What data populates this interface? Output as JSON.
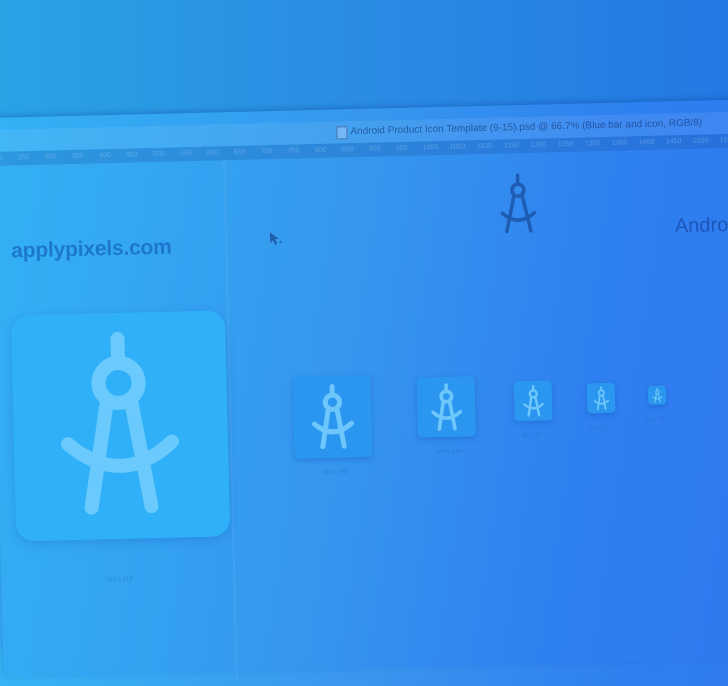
{
  "window": {
    "title": "Android Product Icon Template (9-15).psd @ 66.7% (Blue bar and icon, RGB/8)",
    "ruler_ticks": [
      "200",
      "250",
      "300",
      "350",
      "400",
      "450",
      "500",
      "550",
      "600",
      "650",
      "700",
      "750",
      "800",
      "850",
      "900",
      "950",
      "1000",
      "1050",
      "1100",
      "1150",
      "1200",
      "1250",
      "1300",
      "1350",
      "1400",
      "1450",
      "1500",
      "1550",
      "1600",
      "1650",
      "1700",
      "1750",
      "1800",
      "1850",
      "1900",
      "1950",
      "2000"
    ]
  },
  "canvas": {
    "brand": "applypixels.com",
    "right_title": "Andro",
    "large_icon_label": "512 x 512",
    "icon_sizes": [
      {
        "label": "192 x 192"
      },
      {
        "label": "144 x 144"
      },
      {
        "label": "96 x 96"
      },
      {
        "label": "72 x 72"
      },
      {
        "label": "48 x 48"
      }
    ]
  },
  "colors": {
    "background_left": "#36b4f6",
    "background_right": "#3179ee",
    "icon_tile": "#2b96f0",
    "large_icon": "#2fb0f8",
    "glyph": "#7fd3ff",
    "brand_text": "#196ec8"
  },
  "icons": {
    "app_glyph": "drafting-compass-icon",
    "cursor": "arrow-cursor-icon",
    "document": "document-icon"
  }
}
